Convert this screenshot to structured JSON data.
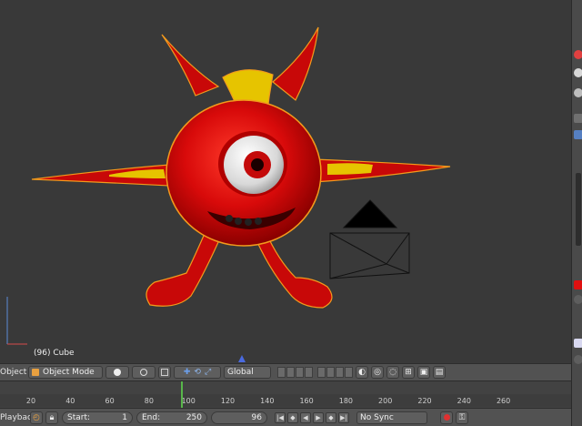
{
  "viewport": {
    "object_label": "(96) Cube"
  },
  "header": {
    "object_menu": "Object",
    "mode": "Object Mode",
    "orientation": "Global"
  },
  "timeline": {
    "ticks": [
      "20",
      "40",
      "60",
      "80",
      "100",
      "120",
      "140",
      "160",
      "180",
      "200",
      "220",
      "240",
      "260"
    ],
    "tick_values": [
      20,
      40,
      60,
      80,
      100,
      120,
      140,
      160,
      180,
      200,
      220,
      240,
      260
    ],
    "current_frame": 96
  },
  "playback": {
    "menu": "Playback",
    "start_label": "Start:",
    "start_value": "1",
    "end_label": "End:",
    "end_value": "250",
    "frame_value": "96",
    "sync": "No Sync"
  },
  "colors": {
    "creature_red": "#d80a0a",
    "creature_yellow": "#e6c400",
    "selection_outline": "#f39a1c",
    "current_frame": "#58b64a"
  },
  "icons": [
    "cube-icon",
    "sphere-icon",
    "pivot-icon",
    "manipulator-icon",
    "keyframe-icon",
    "play-icon",
    "record-icon",
    "key-icon"
  ]
}
